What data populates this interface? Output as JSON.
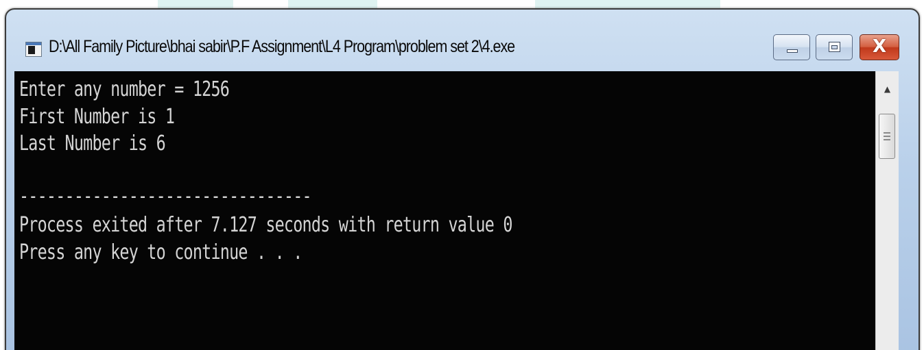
{
  "window": {
    "title": "D:\\All Family Picture\\bhai sabir\\P.F Assignment\\L4 Program\\problem set 2\\4.exe",
    "icon": "console-app-icon",
    "controls": {
      "minimize_icon": "minimize-icon",
      "maximize_icon": "maximize-icon",
      "close_label": "X"
    }
  },
  "console": {
    "lines": [
      "Enter any number = 1256",
      "First Number is 1",
      "Last Number is 6",
      "",
      "--------------------------------",
      "Process exited after 7.127 seconds with return value 0",
      "Press any key to continue . . ."
    ]
  },
  "scrollbar": {
    "up_arrow": "▲"
  },
  "colors": {
    "console_bg": "#050505",
    "console_text": "#d4d4d4",
    "close_button": "#c0391b",
    "frame": "#b9d0ea"
  }
}
